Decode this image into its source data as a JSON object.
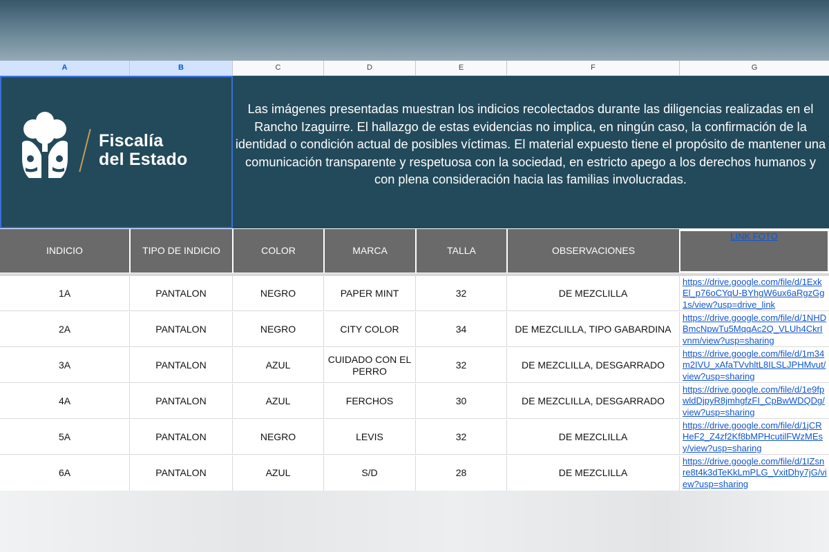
{
  "columns": [
    "A",
    "B",
    "C",
    "D",
    "E",
    "F",
    "G"
  ],
  "logo": {
    "line1": "Fiscalía",
    "line2": "del Estado"
  },
  "banner_text": "Las imágenes presentadas muestran los indicios recolectados durante las diligencias realizadas en el Rancho Izaguirre. El hallazgo de estas evidencias no implica, en ningún caso, la confirmación de la identidad o condición actual de posibles víctimas. El material expuesto tiene el propósito de mantener una comunicación transparente y respetuosa con la sociedad, en estricto apego a los derechos humanos y con plena consideración hacia las familias involucradas.",
  "headers": {
    "indicio": "INDICIO",
    "tipo": "TIPO DE INDICIO",
    "color": "COLOR",
    "marca": "MARCA",
    "talla": "TALLA",
    "observaciones": "OBSERVACIONES",
    "link": "LINK FOTO"
  },
  "rows": [
    {
      "indicio": "1A",
      "tipo": "PANTALON",
      "color": "NEGRO",
      "marca": "PAPER MINT",
      "talla": "32",
      "observaciones": "DE MEZCLILLA",
      "link": "https://drive.google.com/file/d/1ExkEl_p76oCYqU-BYhgW6ux6aRgzGg1s/view?usp=drive_link"
    },
    {
      "indicio": "2A",
      "tipo": "PANTALON",
      "color": "NEGRO",
      "marca": "CITY COLOR",
      "talla": "34",
      "observaciones": "DE MEZCLILLA, TIPO GABARDINA",
      "link": "https://drive.google.com/file/d/1NHDBmcNpwTu5MqqAc2Q_VLUh4CkrIvnm/view?usp=sharing"
    },
    {
      "indicio": "3A",
      "tipo": "PANTALON",
      "color": "AZUL",
      "marca": "CUIDADO CON EL PERRO",
      "talla": "32",
      "observaciones": "DE MEZCLILLA, DESGARRADO",
      "link": "https://drive.google.com/file/d/1m34m2IVU_xAfaTVvhltL8ILSLJPHMvut/view?usp=sharing"
    },
    {
      "indicio": "4A",
      "tipo": "PANTALON",
      "color": "AZUL",
      "marca": "FERCHOS",
      "talla": "30",
      "observaciones": "DE MEZCLILLA, DESGARRADO",
      "link": "https://drive.google.com/file/d/1e9fpwldDjpyR8jmhgfzFI_CpBwWDQDg/view?usp=sharing"
    },
    {
      "indicio": "5A",
      "tipo": "PANTALON",
      "color": "NEGRO",
      "marca": "LEVIS",
      "talla": "32",
      "observaciones": "DE MEZCLILLA",
      "link": "https://drive.google.com/file/d/1jCRHeF2_Z4zf2Kf8bMPHcutilFWzMEsy/view?usp=sharing"
    },
    {
      "indicio": "6A",
      "tipo": "PANTALON",
      "color": "AZUL",
      "marca": "S/D",
      "talla": "28",
      "observaciones": "DE MEZCLILLA",
      "link": "https://drive.google.com/file/d/1IZsnre8t4k3dTeKkLmPLG_VxitDhy7jG/view?usp=sharing"
    }
  ],
  "colors": {
    "banner": "#234a5a",
    "header_cell": "#6a6a6a",
    "link": "#1155cc",
    "selection": "#3a6fd8"
  }
}
